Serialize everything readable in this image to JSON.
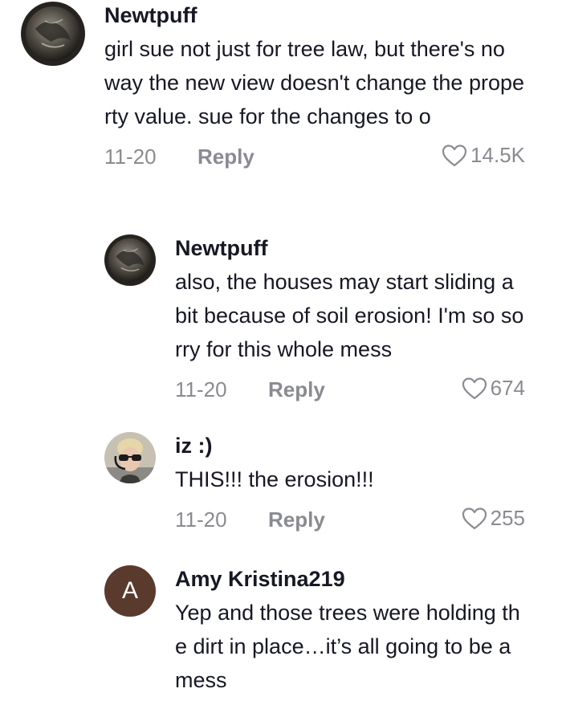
{
  "comments": [
    {
      "username": "Newtpuff",
      "text": "girl sue not just for tree law, but there's no way the new view doesn't change the property value. sue for the changes to o",
      "date": "11-20",
      "reply_label": "Reply",
      "likes": "14.5K",
      "avatar_icon": "moon-avatar-icon"
    },
    {
      "username": "Newtpuff",
      "text": "also, the houses may start sliding a bit because of soil erosion! I'm so sorry for this whole mess",
      "date": "11-20",
      "reply_label": "Reply",
      "likes": "674",
      "avatar_icon": "moon-avatar-icon"
    },
    {
      "username": "iz :)",
      "text": "THIS!!! the erosion!!!",
      "date": "11-20",
      "reply_label": "Reply",
      "likes": "255",
      "avatar_icon": "photo-avatar-icon"
    },
    {
      "username": "Amy Kristina219",
      "text": "Yep and those trees were holding the dirt in place…it’s all going to be a mess",
      "avatar_letter": "A",
      "avatar_color": "#5a3a2c"
    }
  ]
}
